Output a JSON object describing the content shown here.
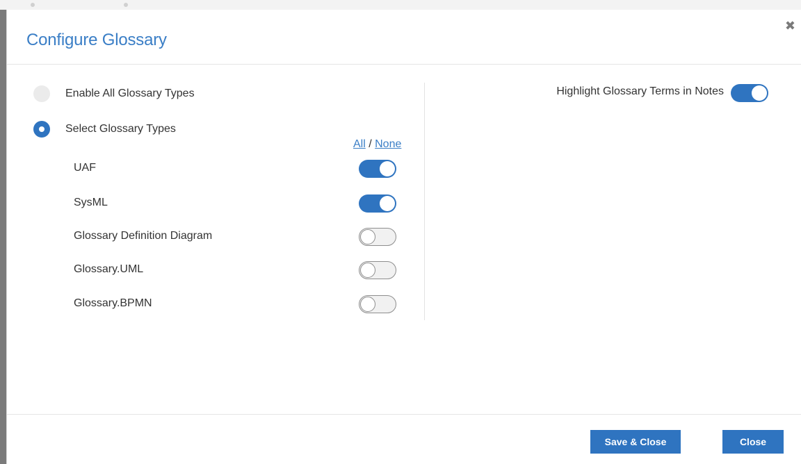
{
  "dialog": {
    "title": "Configure Glossary",
    "close_icon": "close-x-icon"
  },
  "mode": {
    "enable_all_label": "Enable All Glossary Types",
    "enable_all_selected": false,
    "select_types_label": "Select Glossary Types",
    "select_types_selected": true
  },
  "all_none": {
    "all_label": "All",
    "separator": " / ",
    "none_label": "None"
  },
  "glossary_types": [
    {
      "label": "UAF",
      "enabled": true
    },
    {
      "label": "SysML",
      "enabled": true
    },
    {
      "label": "Glossary Definition Diagram",
      "enabled": false
    },
    {
      "label": "Glossary.UML",
      "enabled": false
    },
    {
      "label": "Glossary.BPMN",
      "enabled": false
    }
  ],
  "highlight": {
    "label": "Highlight Glossary Terms in Notes",
    "enabled": true
  },
  "footer": {
    "save_close_label": "Save & Close",
    "close_label": "Close"
  },
  "colors": {
    "accent": "#2f74c0",
    "title": "#3a7ec6"
  }
}
